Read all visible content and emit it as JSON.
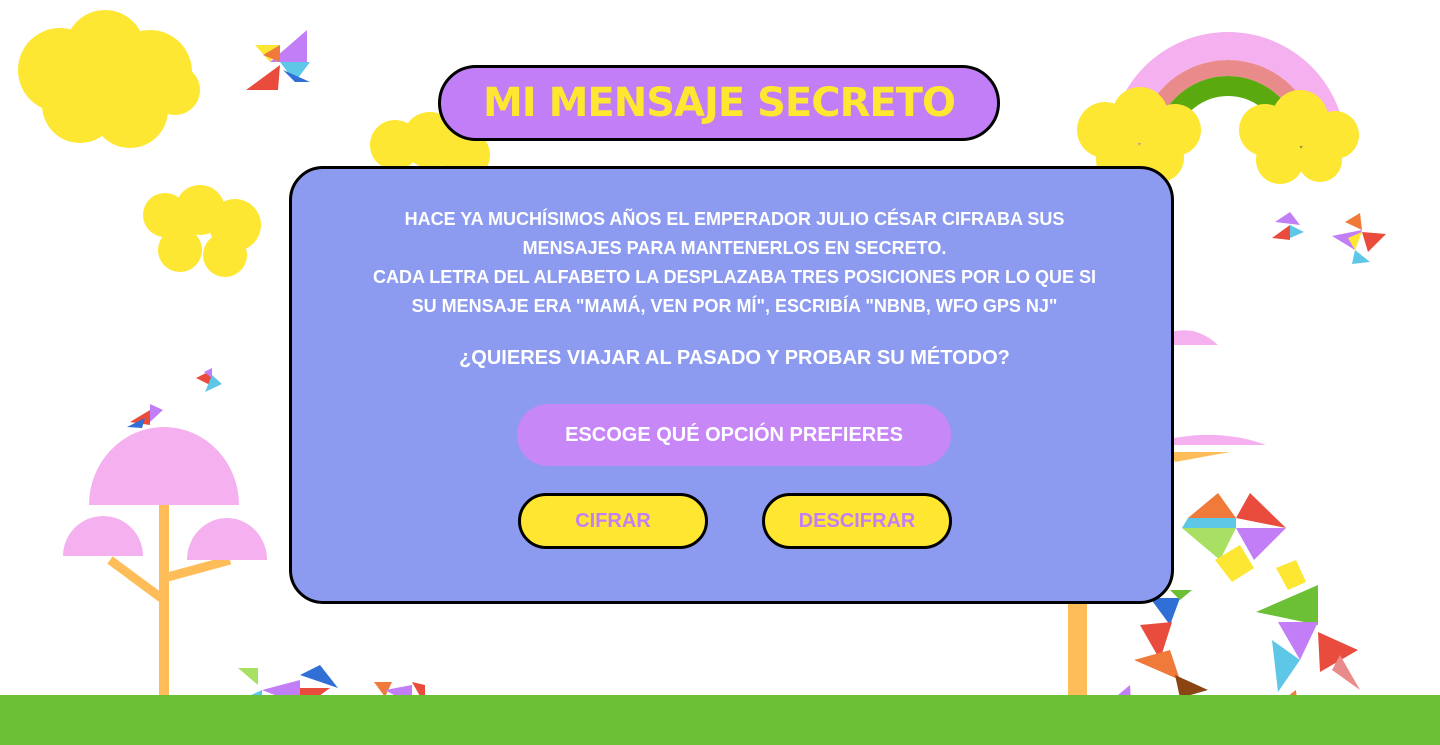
{
  "title": "MI MENSAJE SECRETO",
  "story": {
    "line1": "HACE YA MUCHÍSIMOS AÑOS EL EMPERADOR JULIO CÉSAR CIFRABA SUS",
    "line2": "MENSAJES PARA MANTENERLOS EN SECRETO.",
    "line3": "CADA LETRA DEL ALFABETO LA DESPLAZABA TRES POSICIONES POR LO QUE SI",
    "line4": "SU MENSAJE ERA \"MAMÁ, VEN POR MÍ\", ESCRIBÍA \"NBNB, WFO GPS NJ\""
  },
  "question": "¿QUIERES VIAJAR AL PASADO Y PROBAR SU MÉTODO?",
  "choose_label": "ESCOGE QUÉ OPCIÓN PREFIERES",
  "buttons": {
    "encrypt": "CIFRAR",
    "decrypt": "DESCIFRAR"
  },
  "colors": {
    "background": "#ffffff",
    "panel": "#8c9bef",
    "title_pill": "#c17ef6",
    "title_text": "#ffe731",
    "button_fill": "#ffe731",
    "button_text": "#c57ff4",
    "grass": "#6bc036",
    "cloud": "#fde733",
    "tree_pink": "#f5b0f0",
    "trunk": "#ffbd59"
  },
  "decor_icons": [
    "cloud-icon",
    "rainbow-icon",
    "tree-icon",
    "tangram-bird-icon",
    "tangram-animal-icon",
    "tangram-heart-icon",
    "tangram-runner-icon"
  ]
}
